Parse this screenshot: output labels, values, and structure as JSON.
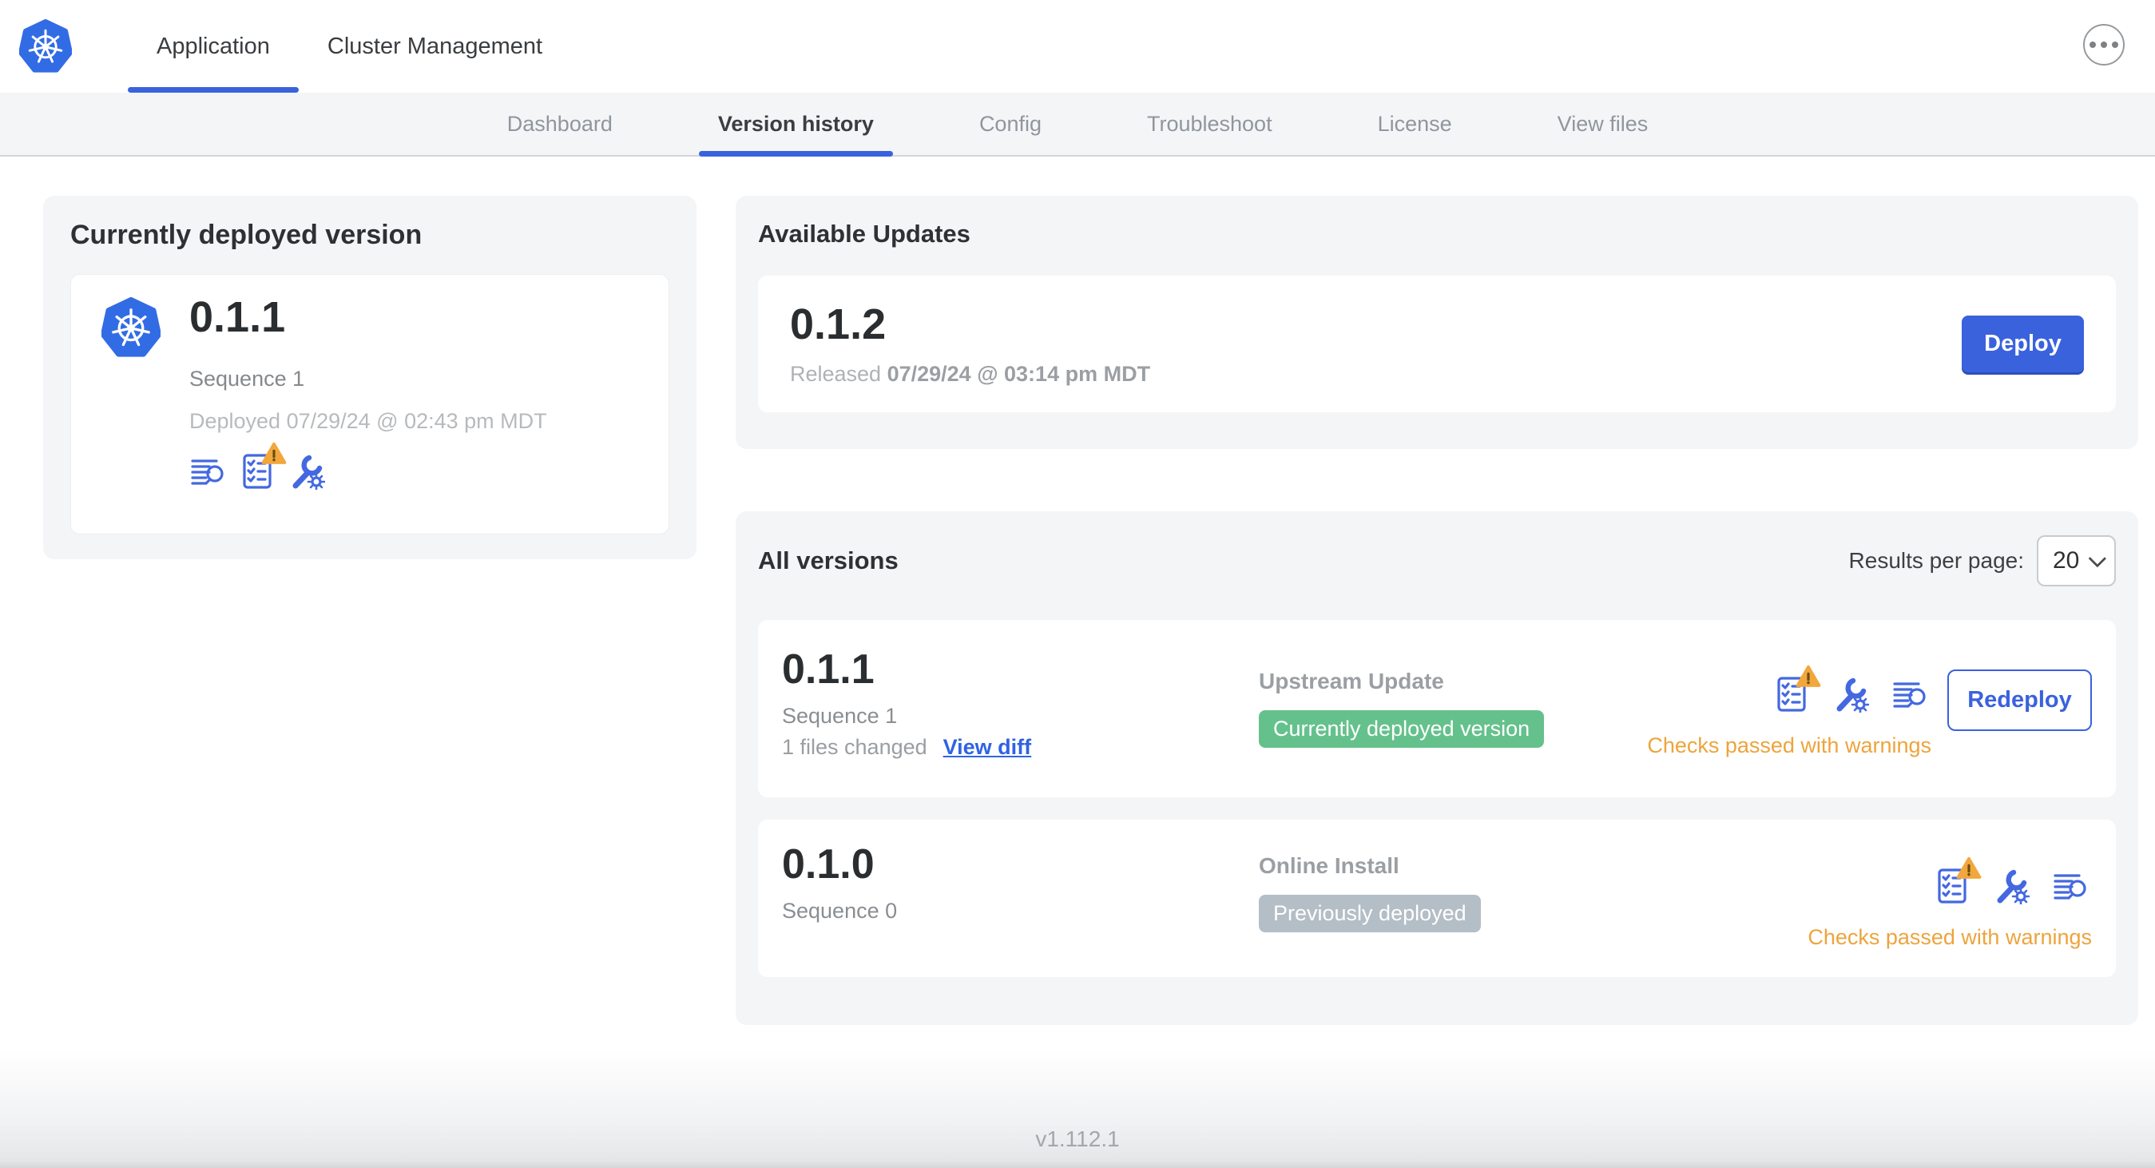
{
  "header": {
    "tabs": [
      {
        "label": "Application"
      },
      {
        "label": "Cluster Management"
      }
    ],
    "active_tab": "Application",
    "menu_icon": "ellipsis-icon"
  },
  "subnav": {
    "tabs": [
      {
        "label": "Dashboard"
      },
      {
        "label": "Version history"
      },
      {
        "label": "Config"
      },
      {
        "label": "Troubleshoot"
      },
      {
        "label": "License"
      },
      {
        "label": "View files"
      }
    ],
    "active_tab": "Version history"
  },
  "current_version": {
    "title": "Currently deployed version",
    "version": "0.1.1",
    "sequence": "Sequence 1",
    "deployed": "Deployed 07/29/24 @ 02:43 pm MDT",
    "icons": [
      "release-notes-icon",
      "preflight-checks-warning-icon",
      "config-icon"
    ]
  },
  "available_updates": {
    "title": "Available Updates",
    "version": "0.1.2",
    "released_label": "Released",
    "released_at": "07/29/24 @ 03:14 pm MDT",
    "deploy_button": "Deploy"
  },
  "all_versions": {
    "title": "All versions",
    "results_per_page_label": "Results per page:",
    "results_per_page": "20",
    "rows": [
      {
        "version": "0.1.1",
        "sequence": "Sequence 1",
        "files_changed": "1 files changed",
        "diff_link": "View diff",
        "source": "Upstream Update",
        "badge": "Currently deployed version",
        "badge_color": "#65c18c",
        "status": "Checks passed with warnings",
        "action_button": "Redeploy",
        "icons": [
          "preflight-checks-warning-icon",
          "config-icon",
          "release-notes-icon"
        ]
      },
      {
        "version": "0.1.0",
        "sequence": "Sequence 0",
        "source": "Online Install",
        "badge": "Previously deployed",
        "badge_color": "#b4bec6",
        "status": "Checks passed with warnings",
        "icons": [
          "preflight-checks-warning-icon",
          "config-icon",
          "release-notes-icon"
        ]
      }
    ]
  },
  "footer": {
    "version": "v1.112.1"
  },
  "colors": {
    "accent_blue": "#3a62dd",
    "icon_blue": "#4468e0",
    "link_blue": "#2f63e3",
    "success_green": "#65c18c",
    "muted_badge_gray": "#b4bec6",
    "warning_orange": "#eda43c",
    "kubernetes_blue": "#326ce5"
  }
}
